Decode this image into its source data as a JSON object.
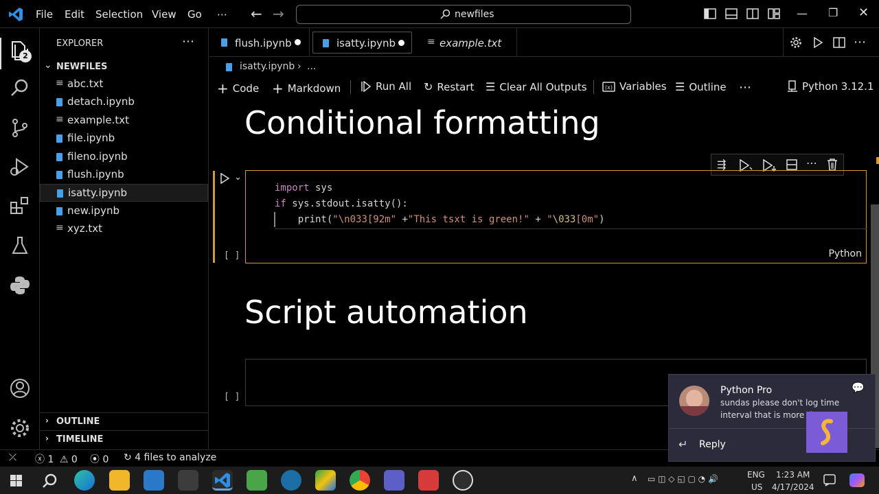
{
  "menu": [
    "File",
    "Edit",
    "Selection",
    "View",
    "Go",
    "⋯"
  ],
  "search": {
    "label": "newfiles"
  },
  "activity": {
    "explorer_badge": "2"
  },
  "sidebar": {
    "title": "EXPLORER",
    "folder": "NEWFILES",
    "files": [
      {
        "name": "abc.txt",
        "type": "txt"
      },
      {
        "name": "detach.ipynb",
        "type": "nb"
      },
      {
        "name": "example.txt",
        "type": "txt"
      },
      {
        "name": "file.ipynb",
        "type": "nb"
      },
      {
        "name": "fileno.ipynb",
        "type": "nb"
      },
      {
        "name": "flush.ipynb",
        "type": "nb"
      },
      {
        "name": "isatty.ipynb",
        "type": "nb"
      },
      {
        "name": "new.ipynb",
        "type": "nb"
      },
      {
        "name": "xyz.txt",
        "type": "txt"
      }
    ],
    "outline": "OUTLINE",
    "timeline": "TIMELINE"
  },
  "tabs": [
    {
      "label": "flush.ipynb"
    },
    {
      "label": "isatty.ipynb"
    },
    {
      "label": "example.txt"
    }
  ],
  "breadcrumb": {
    "file": "isatty.ipynb",
    "more": "..."
  },
  "toolbar": {
    "code": "Code",
    "markdown": "Markdown",
    "run_all": "Run All",
    "restart": "Restart",
    "clear": "Clear All Outputs",
    "variables": "Variables",
    "outline": "Outline",
    "kernel": "Python 3.12.1"
  },
  "notebook": {
    "heading1": "Conditional formatting",
    "heading2": "Script automation",
    "exec_count": "[ ]",
    "lang": "Python",
    "code": {
      "l1a": "import",
      "l1b": " sys",
      "l2a": "if",
      "l2b": " sys.stdout.isatty():",
      "l3a": "    print(",
      "l3b": "\"",
      "l3c": "\\n033[92m\"",
      "l3d": " +",
      "l3e": "\"This tsxt is green!\"",
      "l3f": " + ",
      "l3g": "\"",
      "l3h": "\\033",
      "l3i": "[0m\"",
      "l3j": ")"
    }
  },
  "status": {
    "errors": "1",
    "warnings": "0",
    "ports": "0",
    "analyze": "4 files to analyze"
  },
  "toast": {
    "title": "Python Pro",
    "msg1": "sundas please don't log time",
    "msg2": "interval that is more tha",
    "reply": "Reply"
  },
  "taskbar": {
    "lang1": "ENG",
    "lang2": "US",
    "time": "1:23 AM",
    "date": "4/17/2024"
  },
  "colors": {
    "accent": "#0078d4",
    "cell_border": "#d39b31",
    "keyword": "#c586c0",
    "string": "#ce9178"
  }
}
